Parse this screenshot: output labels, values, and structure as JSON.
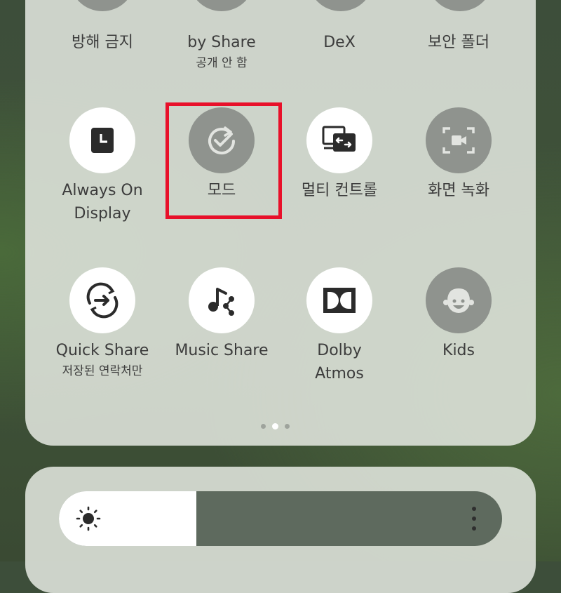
{
  "colors": {
    "highlight": "#e8102a",
    "tile_on": "#ffffff",
    "tile_off": "#8f938e",
    "icon_dark": "#2b2b2b"
  },
  "top_row": [
    {
      "label": "방해 금지",
      "icon": "do-not-disturb-icon"
    },
    {
      "label": "by Share",
      "sub": "공개 안 함",
      "icon": "nearby-share-icon"
    },
    {
      "label": "DeX",
      "icon": "dex-icon"
    },
    {
      "label": "보안 폴더",
      "icon": "secure-folder-icon"
    }
  ],
  "row2": [
    {
      "label_line1": "Always On",
      "label_line2": "Display",
      "icon": "clock-icon",
      "state": "on"
    },
    {
      "label": "모드",
      "icon": "modes-check-icon",
      "state": "off"
    },
    {
      "label": "멀티 컨트롤",
      "icon": "multi-control-icon",
      "state": "on"
    },
    {
      "label": "화면 녹화",
      "icon": "screen-record-icon",
      "state": "off"
    }
  ],
  "row3": [
    {
      "label": "Quick Share",
      "sub": "저장된 연락처만",
      "icon": "quick-share-icon",
      "state": "on"
    },
    {
      "label": "Music Share",
      "icon": "music-share-icon",
      "state": "on"
    },
    {
      "label_line1": "Dolby",
      "label_line2": "Atmos",
      "icon": "dolby-icon",
      "state": "on"
    },
    {
      "label": "Kids",
      "icon": "kids-face-icon",
      "state": "off"
    }
  ],
  "pagination": {
    "pages": 3,
    "current": 2
  },
  "brightness": {
    "level": 0.31,
    "icon": "sun-icon",
    "menu_icon": "more-vertical-icon"
  }
}
